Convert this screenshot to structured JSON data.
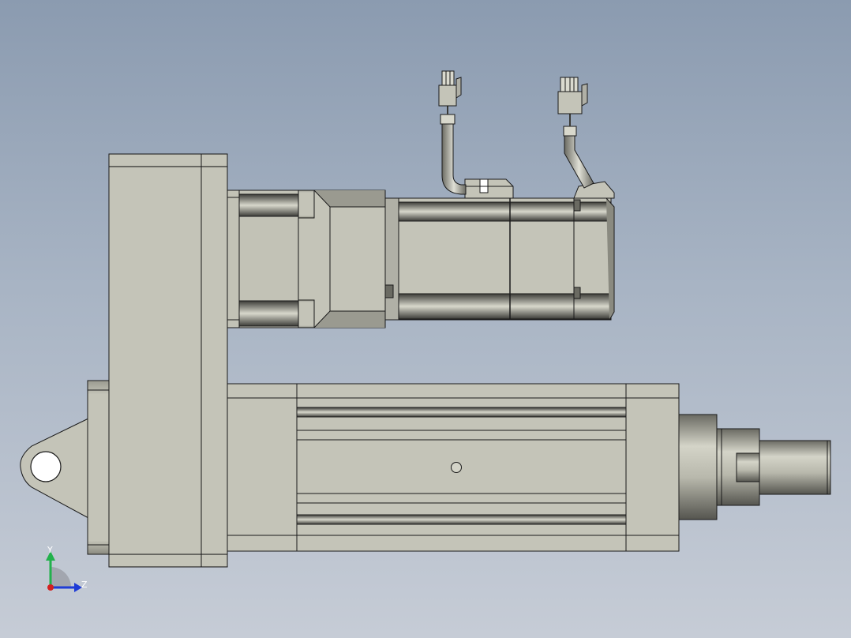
{
  "triad": {
    "y_label": "Y",
    "z_label": "Z",
    "y_color": "#22b14c",
    "z_color": "#1f3cd6",
    "x_color": "#d42020"
  },
  "colors": {
    "body": "#c2c2b6",
    "body_dark": "#8e8e84",
    "shadow": "#5c5c56",
    "edge": "#1a1a1a"
  }
}
